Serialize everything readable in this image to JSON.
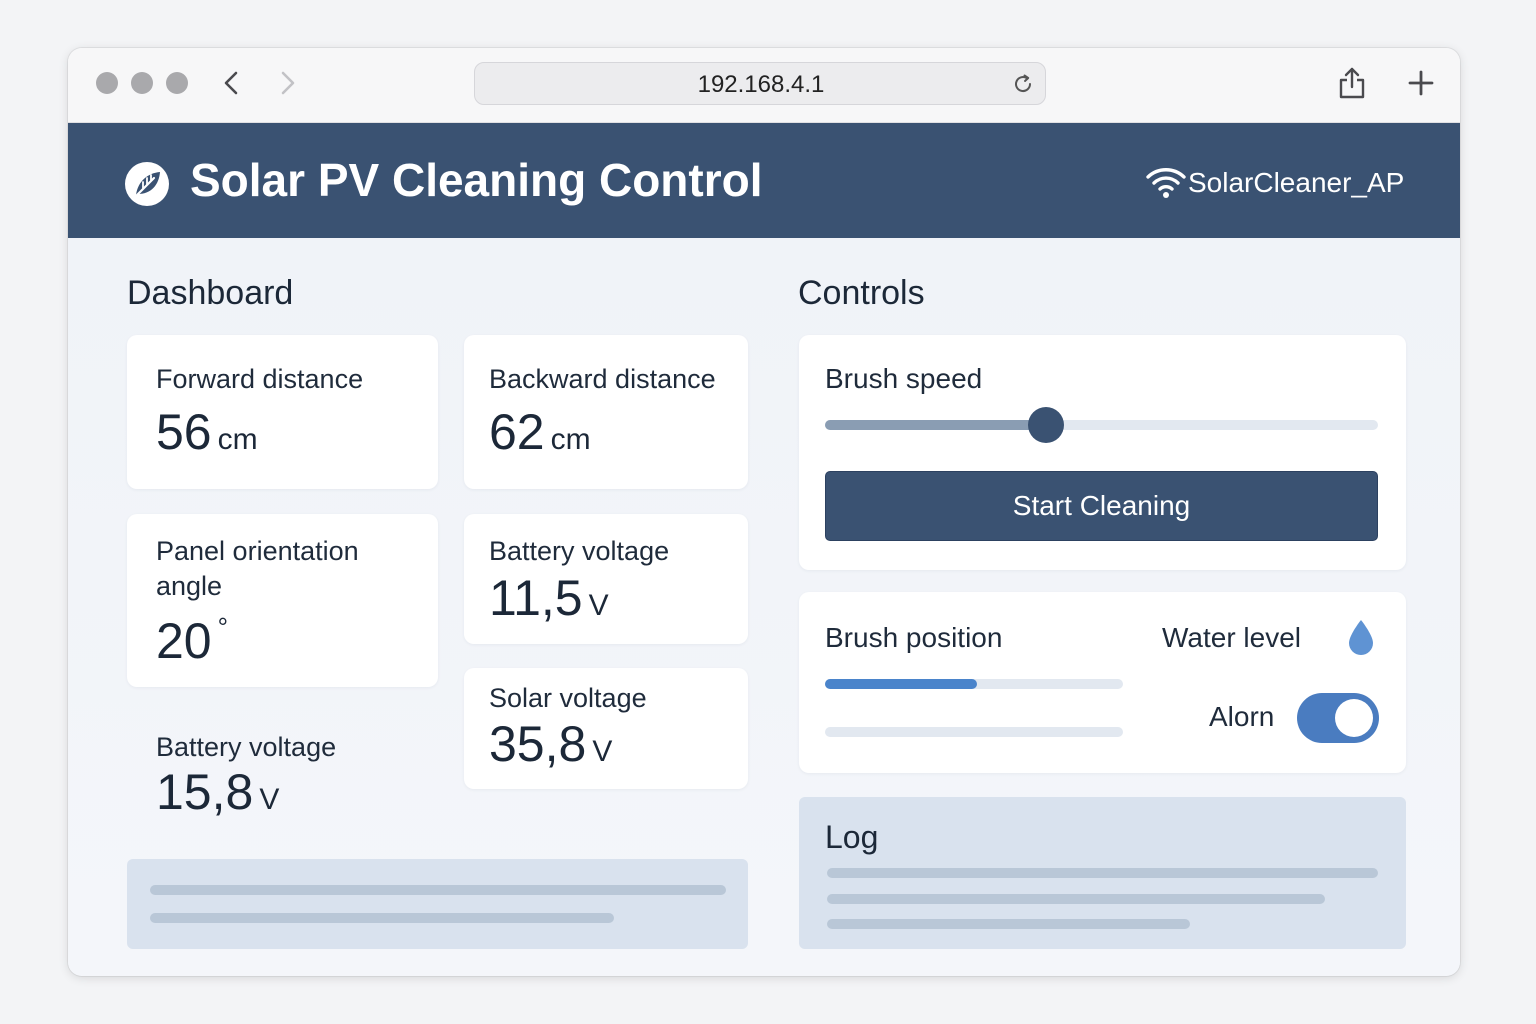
{
  "browser": {
    "url": "192.168.4.1",
    "icons": [
      "back-chevron-icon",
      "forward-chevron-icon",
      "reload-icon",
      "share-icon",
      "plus-icon"
    ]
  },
  "header": {
    "title": "Solar PV Cleaning Control",
    "network_name": "SolarCleaner_AP",
    "logo_icon": "leaf-icon",
    "network_icon": "wifi-icon",
    "background_color": "#3a5272"
  },
  "dashboard": {
    "title": "Dashboard",
    "forward_distance": {
      "label": "Forward distance",
      "value": "56",
      "unit": "cm"
    },
    "backward_distance": {
      "label": "Backward distance",
      "value": "62",
      "unit": "cm"
    },
    "panel_angle": {
      "label": "Panel orientation angle",
      "value": "20",
      "unit": "°"
    },
    "battery_voltage": {
      "label": "Battery voltage",
      "value": "11,5",
      "unit": "V"
    },
    "battery_voltage_2": {
      "label": "Battery voltage",
      "value": "15,8",
      "unit": "V"
    },
    "solar_voltage": {
      "label": "Solar voltage",
      "value": "35,8",
      "unit": "V"
    }
  },
  "controls": {
    "title": "Controls",
    "brush_speed": {
      "label": "Brush speed",
      "level": 0.4
    },
    "start_button": "Start Cleaning",
    "brush_position": {
      "label": "Brush position",
      "level": 0.51
    },
    "water_level": {
      "label": "Water level",
      "icon": "water-drop-icon"
    },
    "alarm": {
      "label": "Alorn",
      "enabled": true
    }
  },
  "log": {
    "title": "Log"
  },
  "colors": {
    "accent": "#3a5272",
    "toggle_on": "#4a7cc0",
    "progress": "#4a84cb"
  }
}
